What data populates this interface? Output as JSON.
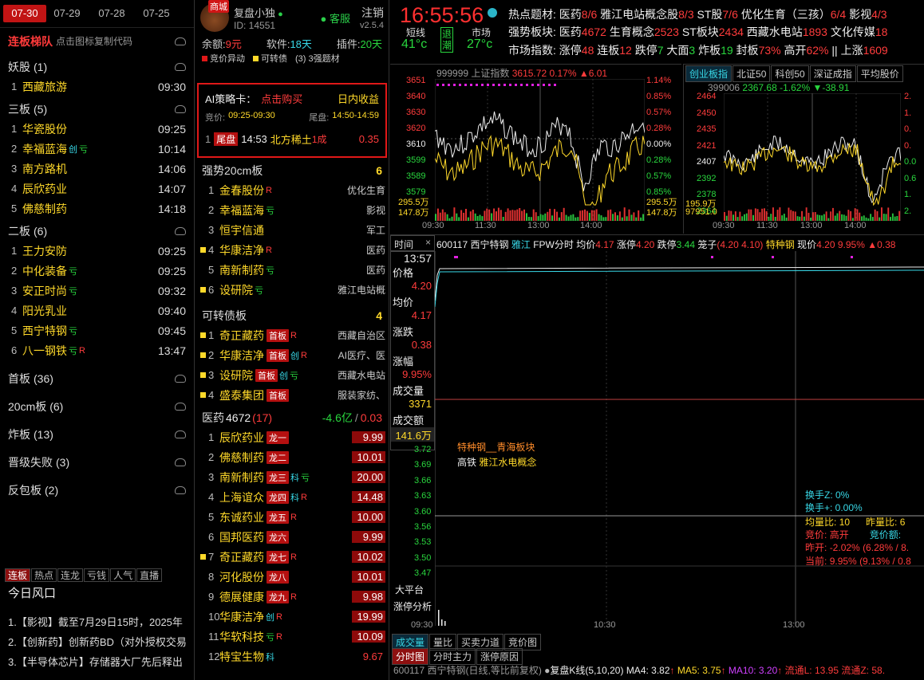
{
  "dates": [
    "07-30",
    "07-29",
    "07-28",
    "07-25"
  ],
  "ladder": {
    "title": "连板梯队",
    "subtitle": "点击图标复制代码"
  },
  "groups": [
    {
      "name": "妖股",
      "count": "(1)",
      "rows": [
        {
          "i": "1",
          "nm": "西藏旅游",
          "tg": "",
          "tm": "09:30"
        }
      ]
    },
    {
      "name": "三板",
      "count": "(5)",
      "rows": [
        {
          "i": "1",
          "nm": "华瓷股份",
          "tg": "",
          "tm": "09:25"
        },
        {
          "i": "2",
          "nm": "幸福蓝海",
          "tg": "创亏",
          "tm": "10:14"
        },
        {
          "i": "3",
          "nm": "南方路机",
          "tg": "",
          "tm": "14:06"
        },
        {
          "i": "4",
          "nm": "辰欣药业",
          "tg": "",
          "tm": "14:07"
        },
        {
          "i": "5",
          "nm": "佛慈制药",
          "tg": "",
          "tm": "14:18"
        }
      ]
    },
    {
      "name": "二板",
      "count": "(6)",
      "rows": [
        {
          "i": "1",
          "nm": "王力安防",
          "tg": "",
          "tm": "09:25"
        },
        {
          "i": "2",
          "nm": "中化装备",
          "tg": "亏",
          "tm": "09:25"
        },
        {
          "i": "3",
          "nm": "安正时尚",
          "tg": "亏",
          "tm": "09:32"
        },
        {
          "i": "4",
          "nm": "阳光乳业",
          "tg": "",
          "tm": "09:40"
        },
        {
          "i": "5",
          "nm": "西宁特钢",
          "tg": "亏",
          "tm": "09:45"
        },
        {
          "i": "6",
          "nm": "八一钢铁",
          "tg": "亏R",
          "tm": "13:47"
        }
      ]
    }
  ],
  "more_groups": [
    {
      "name": "首板",
      "count": "(36)"
    },
    {
      "name": "20cm板",
      "count": "(6)"
    },
    {
      "name": "炸板",
      "count": "(13)"
    },
    {
      "name": "晋级失败",
      "count": "(3)"
    },
    {
      "name": "反包板",
      "count": "(2)"
    }
  ],
  "bottom_tabs": [
    "连板",
    "热点",
    "连龙",
    "亏钱",
    "人气",
    "直播"
  ],
  "wind_title": "今日风口",
  "news": [
    "1.【影视】截至7月29日15时，2025年",
    "2.【创新药】创新药BD（对外授权交易",
    "3.【半导体芯片】存储器大厂先后释出"
  ],
  "account": {
    "badge": "商城",
    "name": "复盘小独",
    "id": "ID: 14551",
    "service": "客服",
    "logout": "注销",
    "version": "v2.5.4"
  },
  "balance": {
    "yue_l": "余额:",
    "yue": "9元",
    "rj_l": "软件:",
    "rj": "18天",
    "cj_l": "插件:",
    "cj": "20天"
  },
  "legend": [
    "竞价异动",
    "可转债",
    "(3) 3强题材"
  ],
  "ai": {
    "title": "AI策略卡：",
    "buy": "点击购买",
    "gain": "日内收益",
    "jj_l": "竞价:",
    "jj": "09:25-09:30",
    "wp_l": "尾盘:",
    "wp": "14:50-14:59",
    "i": "1",
    "tag": "尾盘",
    "time": "14:53",
    "stock": "北方稀土",
    "pos": "1成",
    "val": "0.35"
  },
  "s20": {
    "title": "强势20cm板",
    "count": "6",
    "rows": [
      {
        "i": "1",
        "nm": "金春股份",
        "tg": "R",
        "rt": "优化生育",
        "mk": ""
      },
      {
        "i": "2",
        "nm": "幸福蓝海",
        "tg": "亏",
        "rt": "影视",
        "mk": ""
      },
      {
        "i": "3",
        "nm": "恒宇信通",
        "tg": "",
        "rt": "军工",
        "mk": ""
      },
      {
        "i": "4",
        "nm": "华康洁净",
        "tg": "R",
        "rt": "医药",
        "mk": "y"
      },
      {
        "i": "5",
        "nm": "南新制药",
        "tg": "亏",
        "rt": "医药",
        "mk": ""
      },
      {
        "i": "6",
        "nm": "设研院",
        "tg": "亏",
        "rt": "雅江电站概",
        "mk": "y"
      }
    ]
  },
  "kzz": {
    "title": "可转债板",
    "count": "4",
    "rows": [
      {
        "i": "1",
        "nm": "奇正藏药",
        "pill": "首板",
        "tg": "R",
        "rt": "西藏自治区"
      },
      {
        "i": "2",
        "nm": "华康洁净",
        "pill": "首板",
        "tg": "创R",
        "rt": "AI医疗、医"
      },
      {
        "i": "3",
        "nm": "设研院",
        "pill": "首板",
        "tg": "创亏",
        "rt": "西藏水电站"
      },
      {
        "i": "4",
        "nm": "盛泰集团",
        "pill": "首板",
        "tg": "",
        "rt": "服装家纺、"
      }
    ]
  },
  "yy": {
    "name": "医药",
    "count": "4672",
    "sub": "(17)",
    "chg": "-4.6亿",
    "pct": "0.03",
    "rows": [
      {
        "i": "1",
        "nm": "辰欣药业",
        "pill": "龙一",
        "tg": "",
        "val": "9.99",
        "mk": ""
      },
      {
        "i": "2",
        "nm": "佛慈制药",
        "pill": "龙二",
        "tg": "",
        "val": "10.01",
        "mk": ""
      },
      {
        "i": "3",
        "nm": "南新制药",
        "pill": "龙三",
        "tg": "科亏",
        "val": "20.00",
        "mk": ""
      },
      {
        "i": "4",
        "nm": "上海谊众",
        "pill": "龙四",
        "tg": "科R",
        "val": "14.48",
        "mk": ""
      },
      {
        "i": "5",
        "nm": "东诚药业",
        "pill": "龙五",
        "tg": "R",
        "val": "10.00",
        "mk": ""
      },
      {
        "i": "6",
        "nm": "国邦医药",
        "pill": "龙六",
        "tg": "",
        "val": "9.99",
        "mk": ""
      },
      {
        "i": "7",
        "nm": "奇正藏药",
        "pill": "龙七",
        "tg": "R",
        "val": "10.02",
        "mk": "y"
      },
      {
        "i": "8",
        "nm": "河化股份",
        "pill": "龙八",
        "tg": "",
        "val": "10.01",
        "mk": ""
      },
      {
        "i": "9",
        "nm": "德展健康",
        "pill": "龙九",
        "tg": "R",
        "val": "9.98",
        "mk": ""
      },
      {
        "i": "10",
        "nm": "华康洁净",
        "pill": "",
        "tg": "创R",
        "val": "19.99",
        "mk": ""
      },
      {
        "i": "11",
        "nm": "华软科技",
        "pill": "",
        "tg": "亏R",
        "val": "10.09",
        "mk": ""
      },
      {
        "i": "12",
        "nm": "特宝生物",
        "pill": "",
        "tg": "科",
        "val": "9.67",
        "mk": ""
      }
    ]
  },
  "clock": {
    "time": "16:55:56",
    "dx": "短线",
    "dx_v": "41°c",
    "tc": "退潮",
    "sc": "市场",
    "sc_v": "27°c"
  },
  "topinfo": {
    "l1_label": "热点题材:",
    "l1": [
      {
        "t": "医药",
        "v": "8/6"
      },
      {
        "t": "雅江电站概念股",
        "v": "8/3"
      },
      {
        "t": "ST股",
        "v": "7/6"
      },
      {
        "t": "优化生育（三孩）",
        "v": "6/4"
      },
      {
        "t": "影视",
        "v": "4/3"
      }
    ],
    "l2_label": "强势板块:",
    "l2": [
      {
        "t": "医药",
        "v": "4672"
      },
      {
        "t": "生育概念",
        "v": "2523"
      },
      {
        "t": "ST板块",
        "v": "2434"
      },
      {
        "t": "西藏水电站",
        "v": "1893"
      },
      {
        "t": "文化传媒",
        "v": "18"
      }
    ],
    "l3_label": "市场指数:",
    "l3": [
      {
        "t": "涨停",
        "v": "48",
        "c": "r"
      },
      {
        "t": "连板",
        "v": "12",
        "c": "r"
      },
      {
        "t": "跌停",
        "v": "7",
        "c": "g"
      },
      {
        "t": "大面",
        "v": "3",
        "c": "g"
      },
      {
        "t": "炸板",
        "v": "19",
        "c": "g"
      },
      {
        "t": "封板",
        "v": "73%",
        "c": "r"
      },
      {
        "t": "高开",
        "v": "62%",
        "c": "r"
      },
      {
        "t": "|| 上涨",
        "v": "1609",
        "c": "r"
      }
    ]
  },
  "idx1": {
    "code": "999999 上证指数",
    "price": "3615.72",
    "pct": "0.17%",
    "chg": "▲6.01",
    "yticks": [
      "3651",
      "3640",
      "3630",
      "3620",
      "3610",
      "3599",
      "3589",
      "3579"
    ],
    "rticks": [
      "1.14%",
      "0.85%",
      "0.57%",
      "0.28%",
      "0.00%",
      "0.28%",
      "0.57%",
      "0.85%"
    ],
    "vol": [
      "295.5万",
      "147.8万"
    ],
    "x": [
      "09:30",
      "11:30",
      "13:00",
      "14:00"
    ]
  },
  "idx2": {
    "tabs": [
      "创业板指",
      "北证50",
      "科创50",
      "深证成指",
      "平均股价"
    ],
    "code": "399006",
    "price": "2367.68",
    "pct": "-1.62%",
    "chg": "▼-38.91",
    "yticks": [
      "2464",
      "2450",
      "2435",
      "2421",
      "2407",
      "2392",
      "2378",
      "2364"
    ],
    "rticks": [
      "2.",
      "1.",
      "0.",
      "0.",
      "0.0",
      "0.6",
      "1.",
      "2."
    ],
    "vol": [
      "195.9万",
      "97951.0"
    ],
    "x": [
      "09:30",
      "11:30",
      "13:00",
      "14:00"
    ]
  },
  "stk": {
    "tab1": "时间",
    "time": "13:57",
    "code": "600117 西宁特钢",
    "board": "雅江",
    "fpw": "FPW分时",
    "jj_l": "均价",
    "jj": "4.17",
    "zt_l": "涨停",
    "zt": "4.20",
    "dt_l": "跌停",
    "dt": "3.44",
    "lz_l": "笼子",
    "lz": "(4.20 4.10)",
    "kind": "特种钢",
    "xj_l": "现价",
    "xj": "4.20",
    "xj_pct": "9.95%",
    "xj_chg": "▲0.38",
    "left": [
      {
        "l": "价格",
        "v": "4.20"
      },
      {
        "l": "均价",
        "v": "4.17"
      },
      {
        "l": "涨跌",
        "v": "0.38"
      },
      {
        "l": "涨幅",
        "v": "9.95%"
      },
      {
        "l": "成交量",
        "v": "3371"
      },
      {
        "l": "成交额",
        "v": "141.6万"
      }
    ],
    "yticks": [
      "3.72",
      "3.69",
      "3.66",
      "3.63",
      "3.60",
      "3.56",
      "3.53",
      "3.50",
      "3.47"
    ],
    "ann1": "特种钢__青海板块",
    "ann2": "高铁",
    "ann2b": "雅江水电概念",
    "hs1": "换手Z: 0%",
    "hs2": "换手+: 0.00%",
    "lb_l": "均量比:",
    "lb": "10",
    "zlb_l": "昨量比:",
    "zlb": "6",
    "jj2_l": "竞价:",
    "jj2": "高开",
    "jje_l": "竞价额:",
    "zk_l": "昨开:",
    "zk": "-2.02%",
    "zk2": "(6.28% / 8.",
    "dq_l": "当前:",
    "dq": "9.95%",
    "dq2": "(9.13% / 0.8",
    "dpt": "大平台",
    "ztfx": "涨停分析",
    "x": [
      "09:30",
      "10:30",
      "13:00"
    ],
    "btabs": [
      "成交量",
      "量比",
      "买卖力道",
      "竞价图"
    ],
    "btabs2": [
      "分时图",
      "分时主力",
      "涨停原因"
    ],
    "kline": "600117 西宁特钢(日线,等比前复权)",
    "kl2": "复盘K线(5,10,20)",
    "ma4": "MA4: 3.82",
    "ma5": "MA5: 3.75",
    "ma10": "MA10: 3.20",
    "ll": "流通L: 13.95",
    "lz2": "流通Z: 58."
  }
}
